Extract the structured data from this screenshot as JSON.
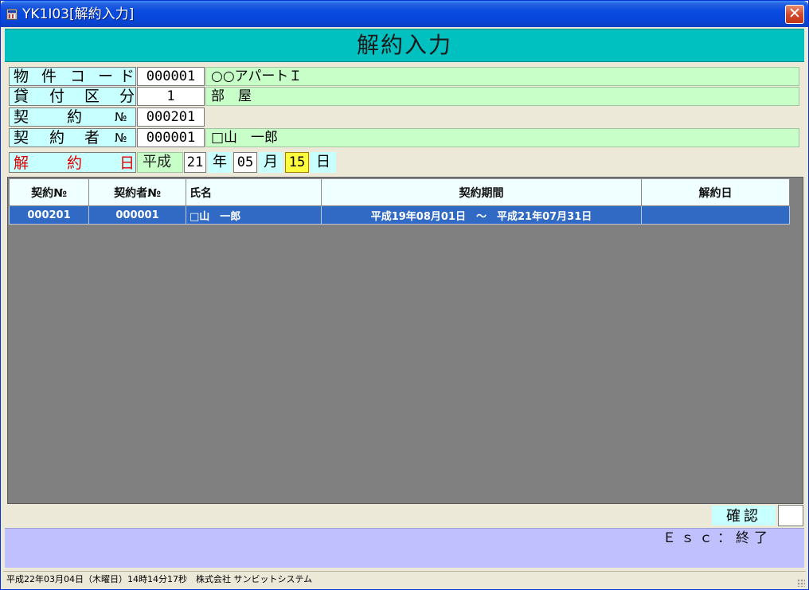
{
  "window": {
    "title": "YK1I03[解約入力]",
    "close_glyph": "✕"
  },
  "header": {
    "title": "解約入力"
  },
  "form": {
    "property_code": {
      "label_chars": [
        "物",
        "件",
        "コ",
        "ー",
        "ド"
      ],
      "value": "000001",
      "name": "○○アパートＩ"
    },
    "loan_type": {
      "label_chars": [
        "貸",
        "付",
        "区",
        "分"
      ],
      "value": "1",
      "name": "部　屋"
    },
    "contract_no": {
      "label_chars": [
        "契",
        "約",
        "№"
      ],
      "value": "000201",
      "name": ""
    },
    "contractor_no": {
      "label_chars": [
        "契",
        "約",
        "者",
        "№"
      ],
      "value": "000001",
      "name": "□山　一郎"
    },
    "cancel_date": {
      "label_chars": [
        "解",
        "約",
        "日"
      ],
      "era": "平成",
      "year": "21",
      "year_unit": "年",
      "month": "05",
      "month_unit": "月",
      "day": "15",
      "day_unit": "日"
    }
  },
  "grid": {
    "columns": [
      "契約№",
      "契約者№",
      "氏名",
      "契約期間",
      "解約日"
    ],
    "rows": [
      {
        "contract_no": "000201",
        "contractor_no": "000001",
        "name": "□山　一郎",
        "period": "平成19年08月01日　～　平成21年07月31日",
        "cancel_date": ""
      }
    ]
  },
  "confirm": {
    "label": "確認",
    "value": ""
  },
  "function_keys": {
    "esc": "Ｅｓｃ：終了"
  },
  "statusbar": {
    "text": "平成22年03月04日（木曜日）14時14分17秒　株式会社 サンビットシステム"
  },
  "colors": {
    "header": "#00c0c0",
    "label_bg": "#c8ffff",
    "name_bg": "#c8ffc8",
    "selected_row": "#316ac5",
    "function_band": "#c0c0ff",
    "cancel_label_text": "#e00000",
    "day_highlight": "#ffff40"
  }
}
